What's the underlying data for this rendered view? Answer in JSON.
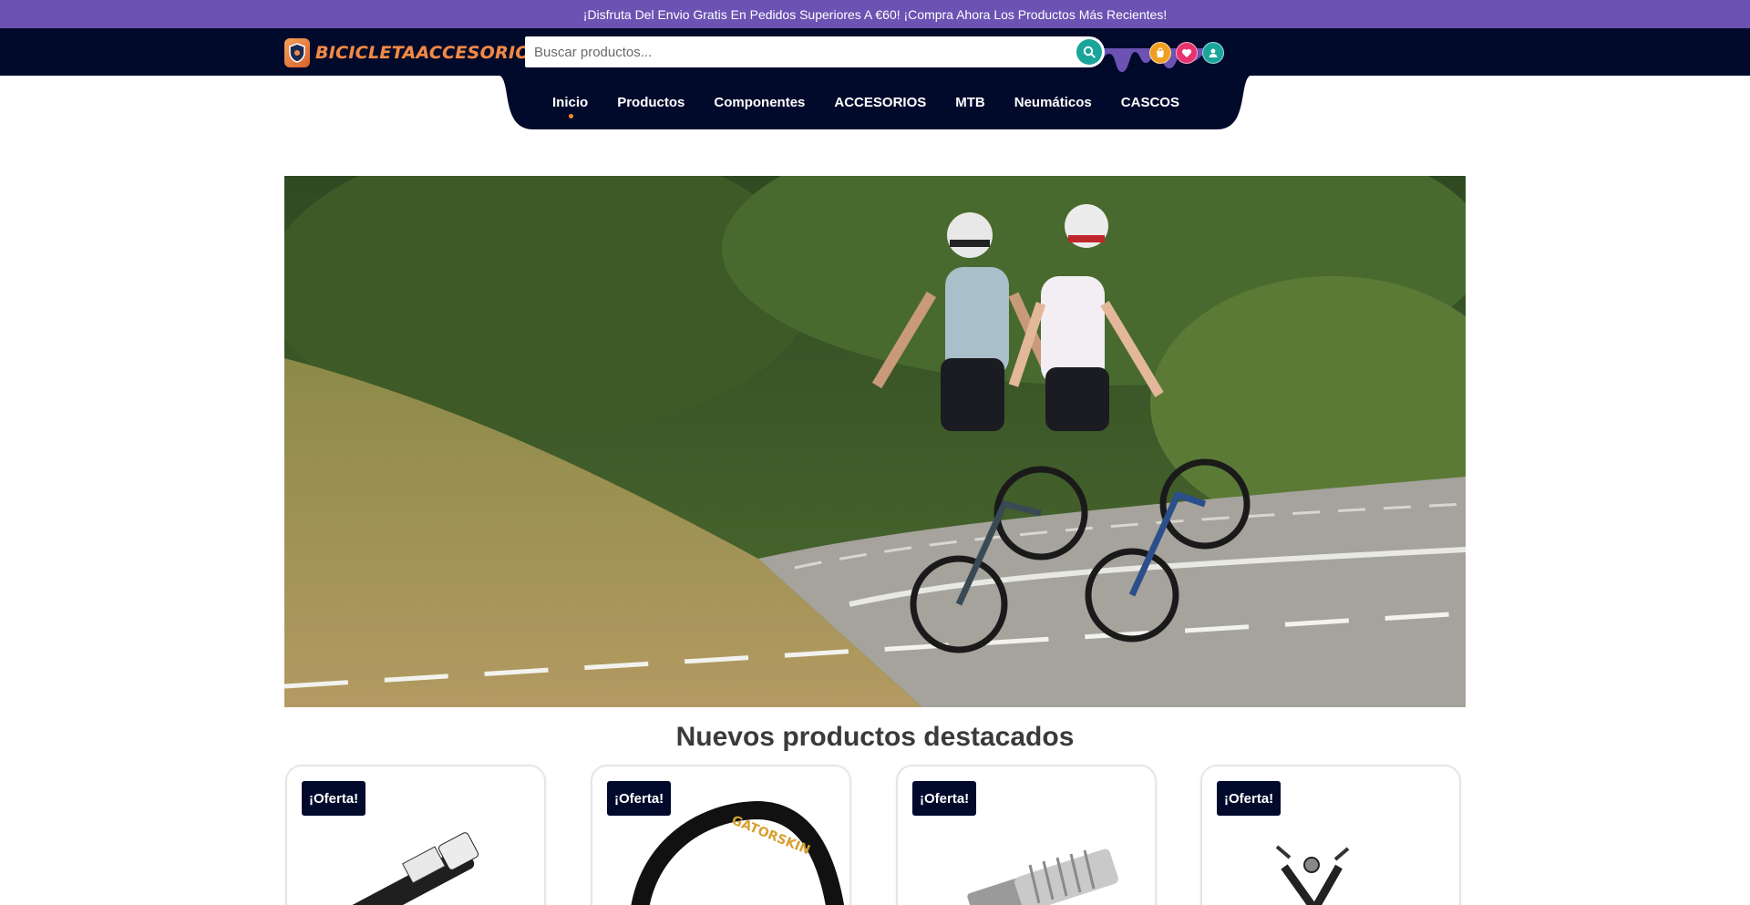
{
  "announcement": "¡Disfruta Del Envio Gratis En Pedidos Superiores A €60! ¡Compra Ahora Los Productos Más Recientes!",
  "brand": {
    "name": "BICICLETAACCESORIOS",
    "color": "#f08a48"
  },
  "search": {
    "placeholder": "Buscar productos...",
    "value": ""
  },
  "header_icons": [
    {
      "name": "cart-icon",
      "color": "#f0a020"
    },
    {
      "name": "heart-icon",
      "color": "#e8326e"
    },
    {
      "name": "user-icon",
      "color": "#1aa59b"
    }
  ],
  "nav": {
    "items": [
      {
        "label": "Inicio",
        "active": true
      },
      {
        "label": "Productos",
        "active": false
      },
      {
        "label": "Componentes",
        "active": false
      },
      {
        "label": "ACCESORIOS",
        "active": false
      },
      {
        "label": "MTB",
        "active": false
      },
      {
        "label": "Neumáticos",
        "active": false
      },
      {
        "label": "CASCOS",
        "active": false
      }
    ]
  },
  "section": {
    "title": "Nuevos productos destacados"
  },
  "products": [
    {
      "badge": "¡Oferta!",
      "image": "multi-tool"
    },
    {
      "badge": "¡Oferta!",
      "image": "gatorskin-tire"
    },
    {
      "badge": "¡Oferta!",
      "image": "metal-bolt"
    },
    {
      "badge": "¡Oferta!",
      "image": "chain-tool"
    }
  ],
  "tire_text": "GATORSKIN",
  "colors": {
    "topbar": "#6b52b3",
    "header": "#020a2c",
    "accent": "#1aa59b",
    "nav_dot": "#f08a28"
  }
}
